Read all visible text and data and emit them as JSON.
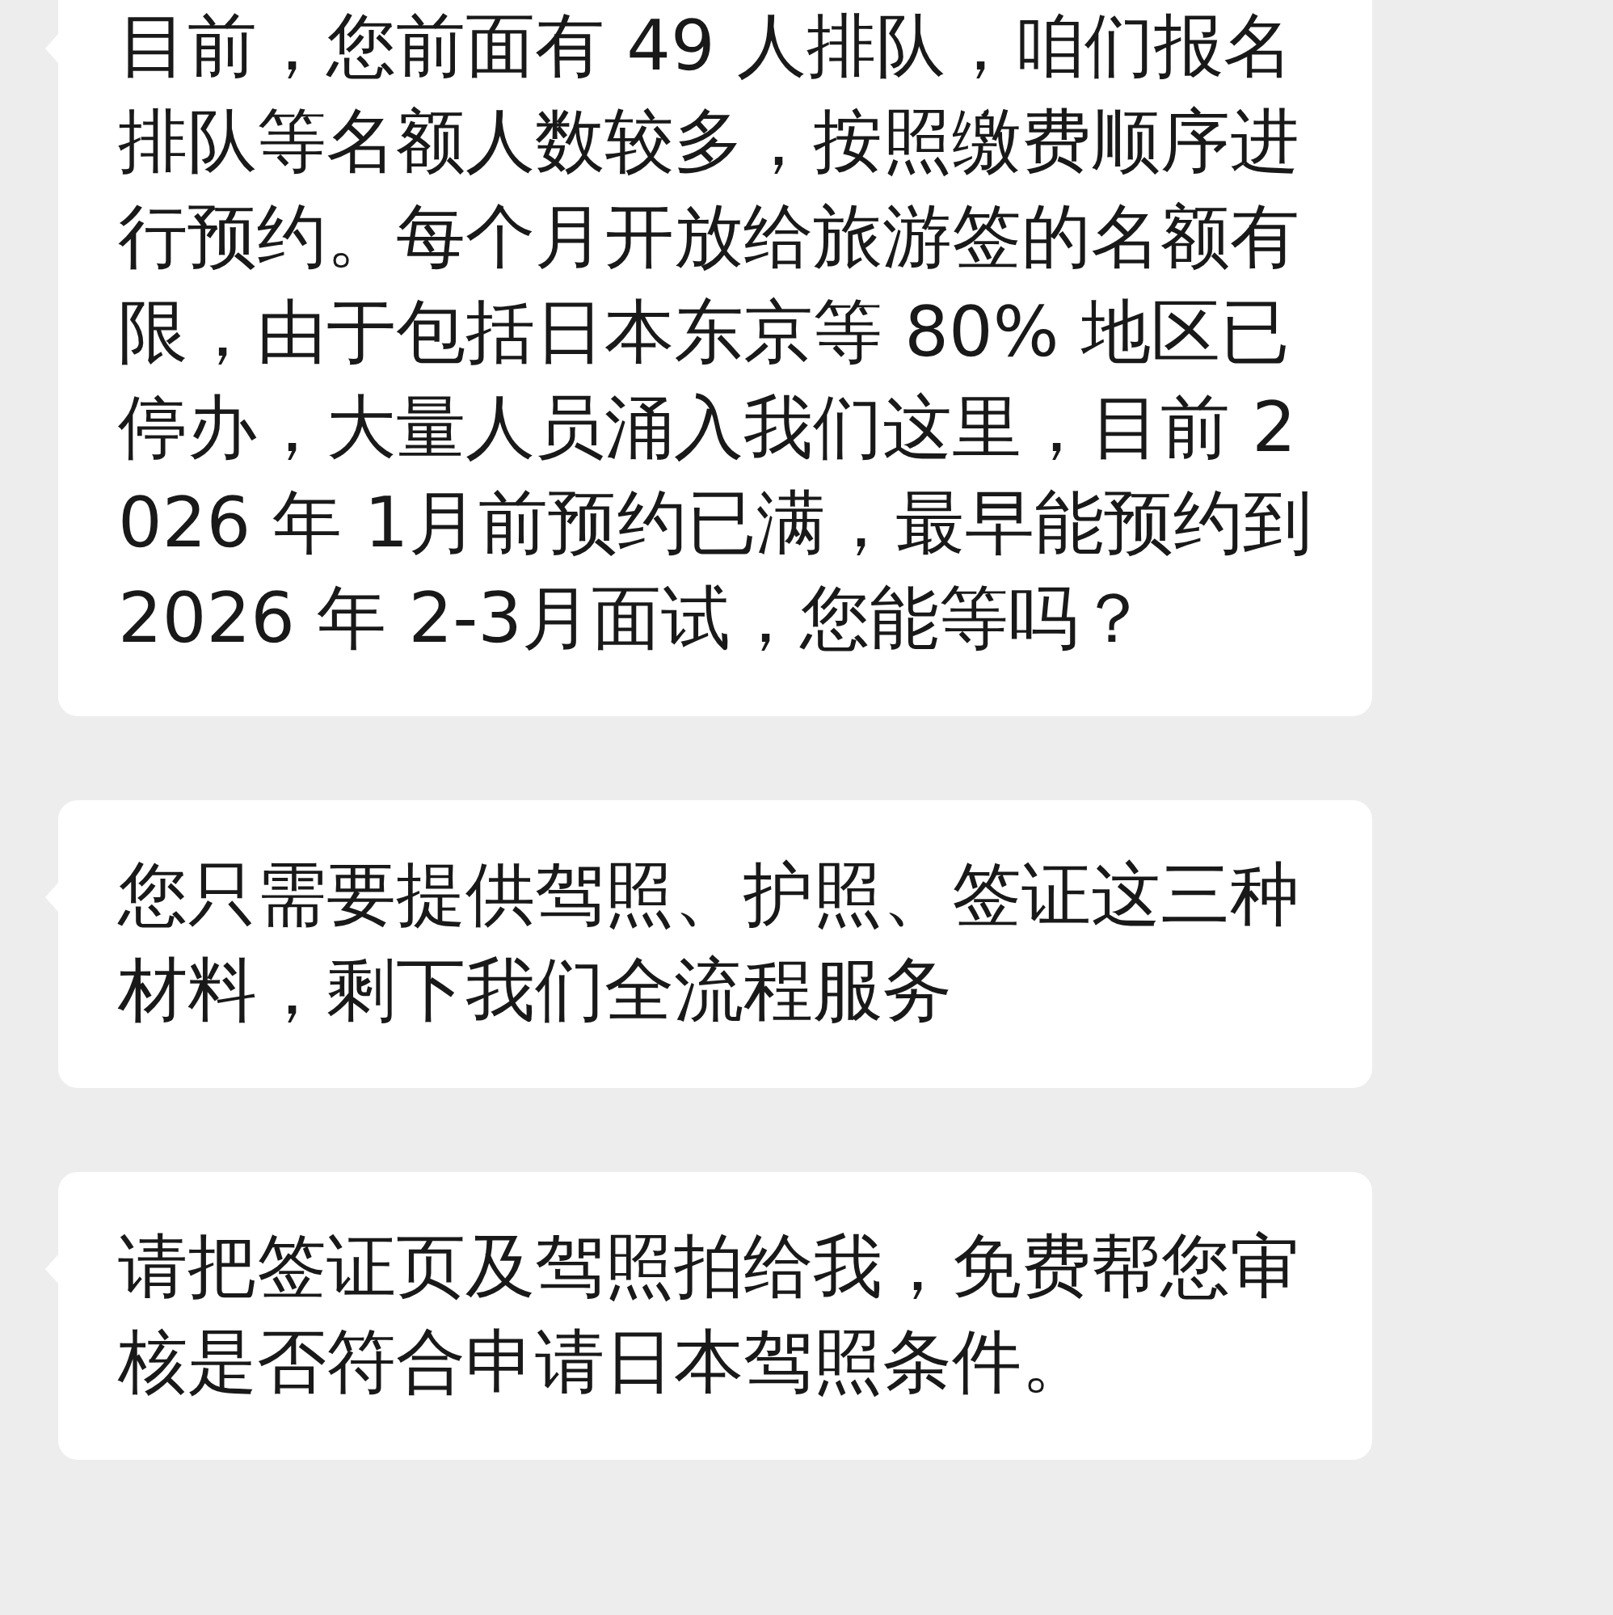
{
  "messages": [
    {
      "text": "目前，您前面有 49 人排队，咱们报名排队等名额人数较多，按照缴费顺序进行预约。每个月开放给旅游签的名额有限，由于包括日本东京等 80% 地区已停办，大量人员涌入我们这里，目前 2026 年 1月前预约已满，最早能预约到 2026 年 2-3月面试，您能等吗？"
    },
    {
      "text": "您只需要提供驾照、护照、签证这三种材料，剩下我们全流程服务"
    },
    {
      "text": "请把签证页及驾照拍给我，免费帮您审核是否符合申请日本驾照条件。"
    }
  ]
}
